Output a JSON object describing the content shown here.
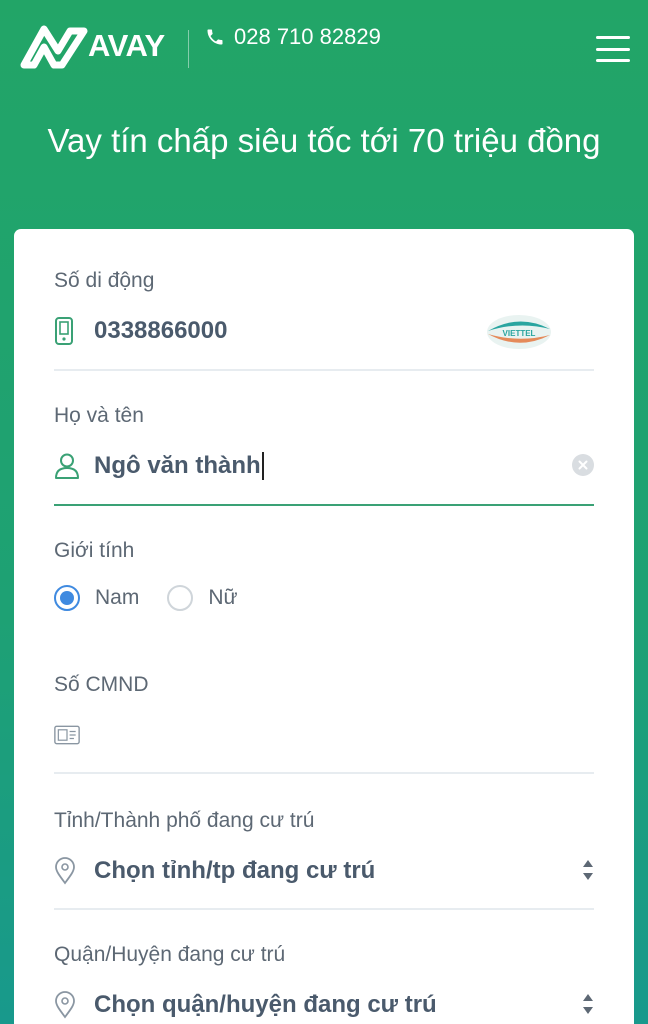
{
  "header": {
    "logo_text": "AVAY",
    "phone": "028 710 82829",
    "menu_icon": "hamburger-icon"
  },
  "headline": "Vay tín chấp siêu tốc tới 70 triệu đồng",
  "colors": {
    "brand_green": "#22a567",
    "active_line": "#3aa175",
    "radio_blue": "#3f8ae0",
    "label_gray": "#5d6874",
    "value_gray": "#4a5a6c"
  },
  "form": {
    "phone": {
      "label": "Số di động",
      "value": "0338866000",
      "carrier": "VIETTEL",
      "icon": "mobile-phone-icon"
    },
    "name": {
      "label": "Họ và tên",
      "value": "Ngô văn thành",
      "icon": "user-icon"
    },
    "gender": {
      "label": "Giới tính",
      "options": [
        "Nam",
        "Nữ"
      ],
      "selected": "Nam"
    },
    "id_number": {
      "label": "Số CMND",
      "value": "",
      "icon": "id-card-icon"
    },
    "province": {
      "label": "Tỉnh/Thành phố đang cư trú",
      "value": "Chọn tỉnh/tp đang cư trú",
      "icon": "location-pin-icon"
    },
    "district": {
      "label": "Quận/Huyện đang cư trú",
      "value": "Chọn quận/huyện đang cư trú",
      "icon": "location-pin-icon"
    }
  }
}
